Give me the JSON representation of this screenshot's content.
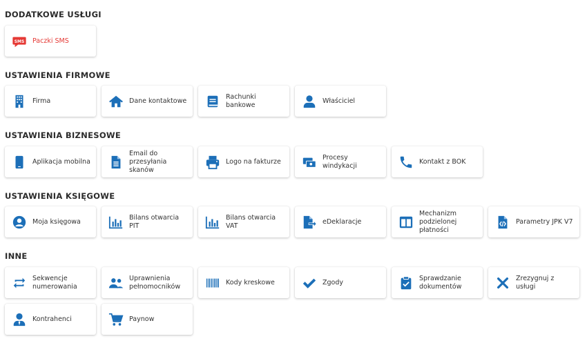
{
  "colors": {
    "icon": "#1c6fb8",
    "sms_red": "#e53935",
    "sms_text": "#e53935"
  },
  "sections": {
    "dodatkowe": "DODATKOWE USŁUGI",
    "firmowe": "USTAWIENIA FIRMOWE",
    "biznesowe": "USTAWIENIA BIZNESOWE",
    "ksiegowe": "USTAWIENIA KSIĘGOWE",
    "inne": "INNE"
  },
  "tiles": {
    "sms": "Paczki SMS",
    "sms_badge": "SMS",
    "firma": "Firma",
    "dane": "Dane kontaktowe",
    "rachunki": "Rachunki bankowe",
    "wlasciciel": "Właściciel",
    "aplikacja": "Aplikacja mobilna",
    "email": "Email do przesyłania skanów",
    "logo": "Logo na fakturze",
    "windykacja": "Procesy windykacji",
    "bok": "Kontakt z BOK",
    "ksiegowa": "Moja księgowa",
    "bilans_pit": "Bilans otwarcia PIT",
    "bilans_vat": "Bilans otwarcia VAT",
    "edeklaracje": "eDeklaracje",
    "mechanizm": "Mechanizm podzielonej płatności",
    "jpk": "Parametry JPK V7",
    "sekwencje": "Sekwencje numerowania",
    "uprawnienia": "Uprawnienia pełnomocników",
    "kody": "Kody kreskowe",
    "zgody": "Zgody",
    "sprawdzanie": "Sprawdzanie dokumentów",
    "zrezygnuj": "Zrezygnuj z usługi",
    "kontrahenci": "Kontrahenci",
    "paynow": "Paynow"
  }
}
